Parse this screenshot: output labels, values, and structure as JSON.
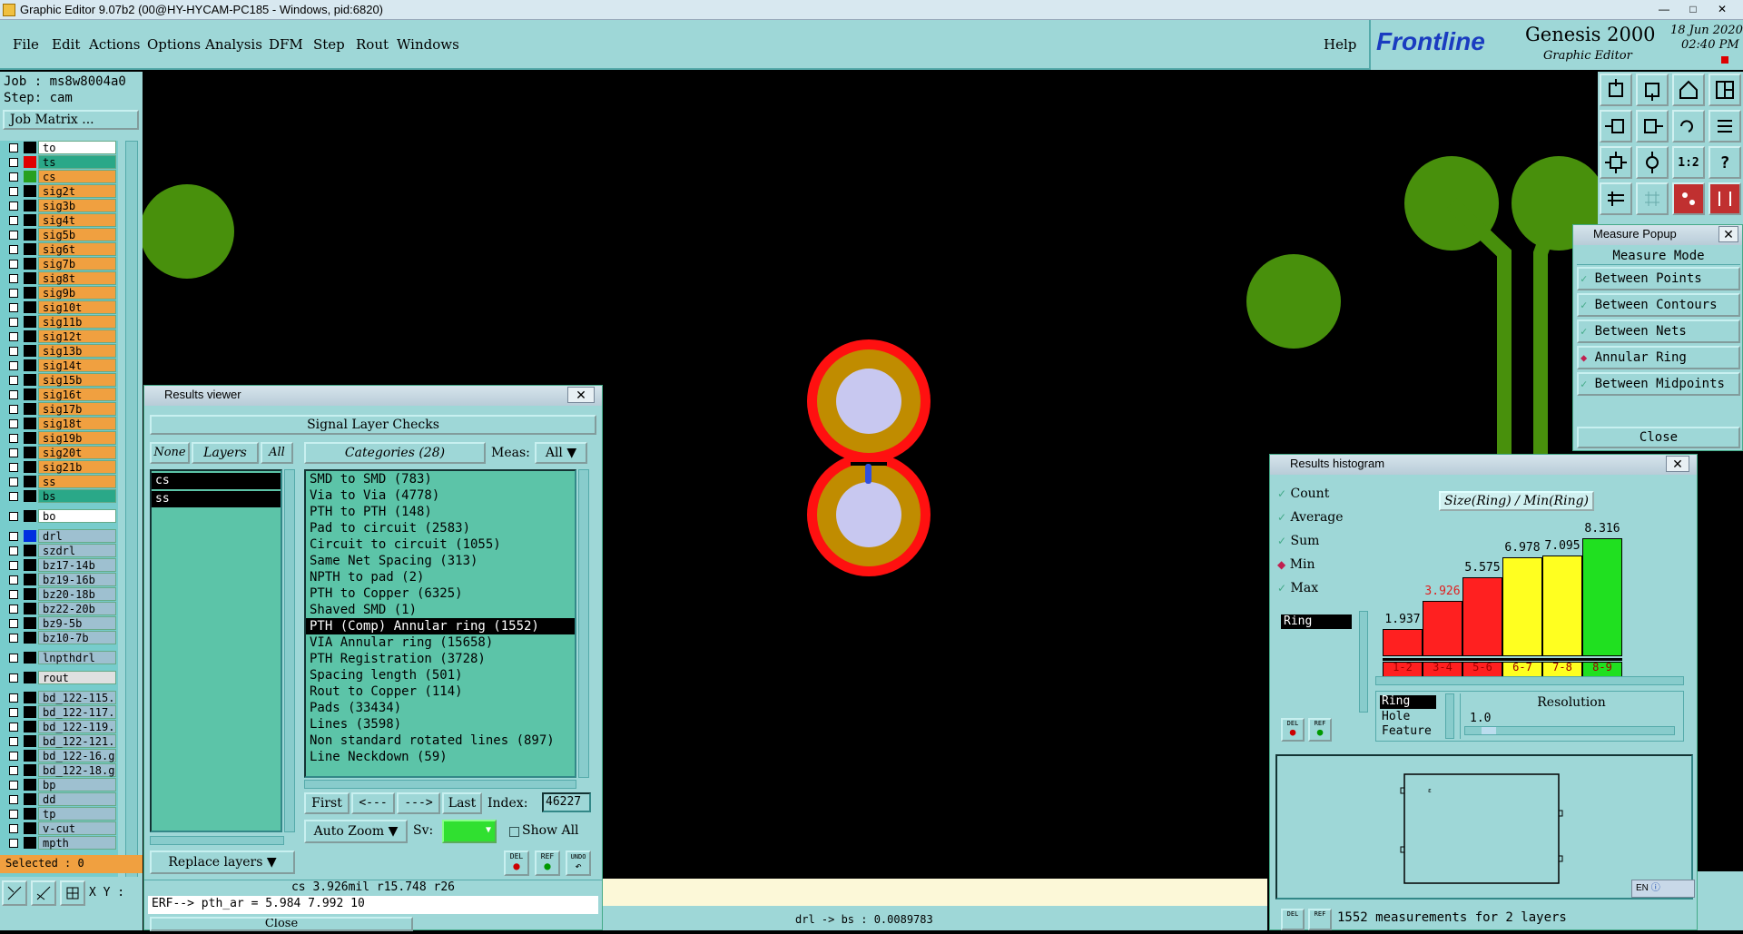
{
  "app": {
    "title": "Graphic Editor 9.07b2 (00@HY-HYCAM-PC185 - Windows, pid:6820)",
    "menus": [
      "File",
      "Edit",
      "Actions",
      "Options",
      "Analysis",
      "DFM",
      "Step",
      "Rout",
      "Windows"
    ],
    "help": "Help",
    "brand": {
      "logo": "Frontline",
      "product": "Genesis 2000",
      "sub": "Graphic Editor",
      "date": "18 Jun 2020",
      "time": "02:40 PM"
    }
  },
  "left": {
    "job": "Job : ms8w8004a0",
    "step": "Step: cam",
    "job_matrix": "Job Matrix ...",
    "layers": [
      {
        "name": "to",
        "color": "#000000",
        "bg": "#ffffff"
      },
      {
        "name": "ts",
        "color": "#e00000",
        "bg": "#2aa888"
      },
      {
        "name": "cs",
        "color": "#28a020",
        "bg": "#f0a040"
      },
      {
        "name": "sig2t",
        "color": "#000000",
        "bg": "#f0a040"
      },
      {
        "name": "sig3b",
        "color": "#000000",
        "bg": "#f0a040"
      },
      {
        "name": "sig4t",
        "color": "#000000",
        "bg": "#f0a040"
      },
      {
        "name": "sig5b",
        "color": "#000000",
        "bg": "#f0a040"
      },
      {
        "name": "sig6t",
        "color": "#000000",
        "bg": "#f0a040"
      },
      {
        "name": "sig7b",
        "color": "#000000",
        "bg": "#f0a040"
      },
      {
        "name": "sig8t",
        "color": "#000000",
        "bg": "#f0a040"
      },
      {
        "name": "sig9b",
        "color": "#000000",
        "bg": "#f0a040"
      },
      {
        "name": "sig10t",
        "color": "#000000",
        "bg": "#f0a040"
      },
      {
        "name": "sig11b",
        "color": "#000000",
        "bg": "#f0a040"
      },
      {
        "name": "sig12t",
        "color": "#000000",
        "bg": "#f0a040"
      },
      {
        "name": "sig13b",
        "color": "#000000",
        "bg": "#f0a040"
      },
      {
        "name": "sig14t",
        "color": "#000000",
        "bg": "#f0a040"
      },
      {
        "name": "sig15b",
        "color": "#000000",
        "bg": "#f0a040"
      },
      {
        "name": "sig16t",
        "color": "#000000",
        "bg": "#f0a040"
      },
      {
        "name": "sig17b",
        "color": "#000000",
        "bg": "#f0a040"
      },
      {
        "name": "sig18t",
        "color": "#000000",
        "bg": "#f0a040"
      },
      {
        "name": "sig19b",
        "color": "#000000",
        "bg": "#f0a040"
      },
      {
        "name": "sig20t",
        "color": "#000000",
        "bg": "#f0a040"
      },
      {
        "name": "sig21b",
        "color": "#000000",
        "bg": "#f0a040"
      },
      {
        "name": "ss",
        "color": "#000000",
        "bg": "#f0a040"
      },
      {
        "name": "bs",
        "color": "#000000",
        "bg": "#2aa888"
      },
      {
        "name": "bo",
        "color": "#000000",
        "bg": "#ffffff"
      },
      {
        "name": "drl",
        "color": "#0030e0",
        "bg": "#9ec0d0"
      },
      {
        "name": "szdrl",
        "color": "#000000",
        "bg": "#9ec0d0"
      },
      {
        "name": "bz17-14b",
        "color": "#000000",
        "bg": "#9ec0d0"
      },
      {
        "name": "bz19-16b",
        "color": "#000000",
        "bg": "#9ec0d0"
      },
      {
        "name": "bz20-18b",
        "color": "#000000",
        "bg": "#9ec0d0"
      },
      {
        "name": "bz22-20b",
        "color": "#000000",
        "bg": "#9ec0d0"
      },
      {
        "name": "bz9-5b",
        "color": "#000000",
        "bg": "#9ec0d0"
      },
      {
        "name": "bz10-7b",
        "color": "#000000",
        "bg": "#9ec0d0"
      },
      {
        "name": "lnpthdrl",
        "color": "#000000",
        "bg": "#9ec0d0"
      },
      {
        "name": "rout",
        "color": "#000000",
        "bg": "#e0e0e0"
      },
      {
        "name": "bd_122-115.",
        "color": "#000000",
        "bg": "#9ec0d0"
      },
      {
        "name": "bd_122-117.",
        "color": "#000000",
        "bg": "#9ec0d0"
      },
      {
        "name": "bd_122-119.",
        "color": "#000000",
        "bg": "#9ec0d0"
      },
      {
        "name": "bd_122-121.",
        "color": "#000000",
        "bg": "#9ec0d0"
      },
      {
        "name": "bd_122-16.g",
        "color": "#000000",
        "bg": "#9ec0d0"
      },
      {
        "name": "bd_122-18.g",
        "color": "#000000",
        "bg": "#9ec0d0"
      },
      {
        "name": "bp",
        "color": "#000000",
        "bg": "#9ec0d0"
      },
      {
        "name": "dd",
        "color": "#000000",
        "bg": "#9ec0d0"
      },
      {
        "name": "tp",
        "color": "#000000",
        "bg": "#9ec0d0"
      },
      {
        "name": "v-cut",
        "color": "#000000",
        "bg": "#9ec0d0"
      },
      {
        "name": "mpth",
        "color": "#000000",
        "bg": "#9ec0d0"
      }
    ],
    "selected": "Selected : 0",
    "xy_label": "X Y :"
  },
  "results_viewer": {
    "title": "Results viewer",
    "header": "Signal Layer Checks",
    "none": "None",
    "layers": "Layers",
    "all": "All",
    "categories": "Categories (28)",
    "meas_label": "Meas:",
    "meas_value": "All",
    "layer_list": [
      "cs",
      "ss"
    ],
    "items": [
      "SMD to SMD (783)",
      "Via to Via (4778)",
      "PTH to PTH (148)",
      "Pad to circuit (2583)",
      "Circuit to circuit (1055)",
      "Same Net Spacing (313)",
      "NPTH to pad (2)",
      "PTH to Copper (6325)",
      "Shaved SMD (1)",
      "PTH (Comp) Annular ring (1552)",
      "VIA Annular ring (15658)",
      "PTH Registration (3728)",
      "Spacing length (501)",
      "Rout to Copper (114)",
      "Pads (33434)",
      "Lines (3598)",
      "Non standard rotated lines (897)",
      "Line Neckdown (59)"
    ],
    "selected_index": 9,
    "first": "First",
    "prev": "<---",
    "next": "--->",
    "last": "Last",
    "index_label": "Index:",
    "index_value": "46227",
    "auto_zoom": "Auto Zoom",
    "sv_label": "Sv:",
    "show_all": "Show All",
    "replace_layers": "Replace layers",
    "status": "cs 3.926mil  r15.748  r26",
    "erf": "ERF--> pth_ar = 5.984 7.992 10",
    "close": "Close",
    "del": "DEL",
    "ref": "REF",
    "undo": "UNDO"
  },
  "measure_popup": {
    "title": "Measure Popup",
    "mode": "Measure Mode",
    "options": [
      "Between Points",
      "Between Contours",
      "Between Nets",
      "Annular Ring",
      "Between Midpoints"
    ],
    "selected": "Annular Ring",
    "close": "Close"
  },
  "histogram": {
    "title": "Results histogram",
    "stats": [
      "Count",
      "Average",
      "Sum",
      "Min",
      "Max"
    ],
    "selected_stat": "Min",
    "field": "Ring",
    "chart_title": "Size(Ring) / Min(Ring)",
    "chart_data": {
      "type": "bar",
      "categories": [
        "1-2",
        "3-4",
        "5-6",
        "6-7",
        "7-8",
        "8-9"
      ],
      "values": [
        1.937,
        3.926,
        5.575,
        6.978,
        7.095,
        8.316
      ],
      "colors": [
        "#ff2020",
        "#ff2020",
        "#ff2020",
        "#ffff20",
        "#ffff20",
        "#20e020"
      ],
      "highlight_index": 1
    },
    "types": [
      "Ring",
      "Hole",
      "Feature"
    ],
    "resolution_label": "Resolution",
    "resolution_value": "1.0",
    "footer": "1552 measurements for 2 layers",
    "del": "DEL",
    "ref": "REF"
  },
  "bottom": {
    "drl_status": "drl -> bs : 0.0089783",
    "lang": "EN"
  },
  "colors": {
    "panel": "#9ed7d7",
    "green_feature": "#48900c",
    "ring_outer": "#ff1010",
    "ring_mid": "#c08c00",
    "hole": "#c8c8f0"
  }
}
